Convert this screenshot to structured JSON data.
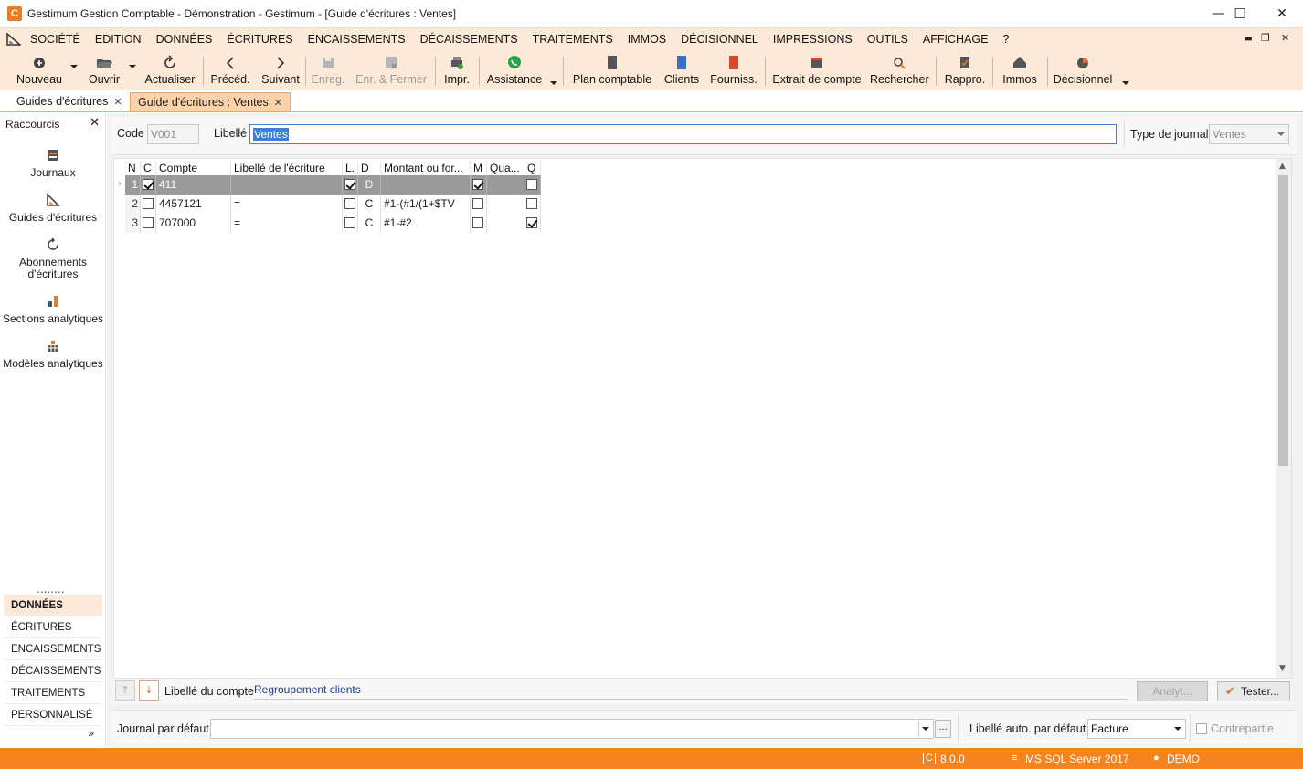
{
  "window": {
    "logo_text": "C",
    "title": "Gestimum Gestion Comptable - Démonstration - Gestimum - [Guide d'écritures : Ventes]",
    "minimize": "—",
    "maximize": "☐",
    "close": "✕"
  },
  "menu": {
    "items": [
      "SOCIÉTÉ",
      "EDITION",
      "DONNÉES",
      "ÉCRITURES",
      "ENCAISSEMENTS",
      "DÉCAISSEMENTS",
      "TRAITEMENTS",
      "IMMOS",
      "DÉCISIONNEL",
      "IMPRESSIONS",
      "OUTILS",
      "AFFICHAGE",
      "?"
    ],
    "mdi_minimize": "▬",
    "mdi_restore": "❐",
    "mdi_close": "✕"
  },
  "toolbar": {
    "nouveau": "Nouveau",
    "ouvrir": "Ouvrir",
    "actualiser": "Actualiser",
    "preced": "Précéd.",
    "suivant": "Suivant",
    "enreg": "Enreg.",
    "enr_fermer": "Enr. & Fermer",
    "impr": "Impr.",
    "assistance": "Assistance",
    "plan_comptable": "Plan comptable",
    "clients": "Clients",
    "fourniss": "Fourniss.",
    "extrait_compte": "Extrait de compte",
    "rechercher": "Rechercher",
    "rappro": "Rappro.",
    "immos": "Immos",
    "decisionnel": "Décisionnel"
  },
  "tabs": [
    {
      "label": "Guides d'écritures",
      "active": false
    },
    {
      "label": "Guide d'écritures : Ventes",
      "active": true
    }
  ],
  "sidebar": {
    "header": "Raccourcis",
    "close": "✕",
    "items": [
      {
        "label": "Journaux"
      },
      {
        "label": "Guides d'écritures"
      },
      {
        "label": "Abonnements d'écritures"
      },
      {
        "label": "Sections analytiques"
      },
      {
        "label": "Modèles analytiques"
      }
    ],
    "dots": "........",
    "categories": [
      "DONNÉES",
      "ÉCRITURES",
      "ENCAISSEMENTS",
      "DÉCAISSEMENTS",
      "TRAITEMENTS",
      "PERSONNALISÉ"
    ],
    "active_category": "DONNÉES",
    "more": "»"
  },
  "form": {
    "code_label": "Code",
    "code_value": "V001",
    "libelle_label": "Libellé",
    "libelle_value": "Ventes",
    "type_journal_label": "Type de journal",
    "type_journal_value": "Ventes"
  },
  "grid": {
    "columns": [
      "N",
      "C",
      "Compte",
      "Libellé de l'écriture",
      "L.",
      "D",
      "Montant ou for...",
      "M",
      "Qua...",
      "Q"
    ],
    "rows": [
      {
        "n": "1",
        "c": true,
        "compte": "411",
        "libelle": "",
        "l": true,
        "d": "D",
        "montant": "",
        "m": true,
        "qua": "",
        "q": false,
        "selected": true
      },
      {
        "n": "2",
        "c": false,
        "compte": "4457121",
        "libelle": "=",
        "l": false,
        "d": "C",
        "montant": "#1-(#1/(1+$TV",
        "m": false,
        "qua": "",
        "q": false,
        "selected": false
      },
      {
        "n": "3",
        "c": false,
        "compte": "707000",
        "libelle": "=",
        "l": false,
        "d": "C",
        "montant": "#1-#2",
        "m": false,
        "qua": "",
        "q": true,
        "selected": false
      }
    ],
    "row_marker": "›"
  },
  "grid_footer": {
    "libelle_compte_label": "Libellé du compte",
    "libelle_compte_value": "Regroupement clients",
    "analyt_button": "Analyt...",
    "tester_button": "Tester..."
  },
  "bottom_form": {
    "journal_defaut_label": "Journal par défaut",
    "journal_defaut_value": "",
    "ellipsis": "...",
    "libelle_auto_label": "Libellé auto. par défaut",
    "libelle_auto_value": "Facture",
    "contrepartie_label": "Contrepartie"
  },
  "status": {
    "version": "8.0.0",
    "db": "MS SQL Server 2017",
    "user": "DEMO"
  },
  "colors": {
    "accent": "#f5831f",
    "ribbon": "#fde9d7",
    "selection": "#3c7fd6"
  }
}
